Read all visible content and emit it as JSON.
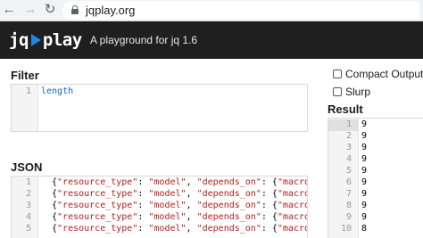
{
  "browser": {
    "url": "jqplay.org",
    "icons": {
      "back": "back-arrow-icon",
      "forward": "forward-arrow-icon",
      "reload": "reload-icon",
      "lock": "lock-icon"
    }
  },
  "header": {
    "logo_jq": "jq",
    "logo_play": "play",
    "tagline": "A playground for jq 1.6",
    "accent": "#1e88e5",
    "background": "#1f1f1f"
  },
  "filter": {
    "label": "Filter",
    "lines": [
      {
        "n": "1",
        "text": "length"
      }
    ]
  },
  "json": {
    "label": "JSON",
    "lines": [
      {
        "n": "1",
        "open": "{",
        "key": "\"resource_type\"",
        "colon": ": ",
        "val": "\"model\"",
        "comma": ", ",
        "key2": "\"depends_on\"",
        "colon2": ": {",
        "key3": "\"macros\""
      },
      {
        "n": "2",
        "open": "{",
        "key": "\"resource_type\"",
        "colon": ": ",
        "val": "\"model\"",
        "comma": ", ",
        "key2": "\"depends_on\"",
        "colon2": ": {",
        "key3": "\"macros\""
      },
      {
        "n": "3",
        "open": "{",
        "key": "\"resource_type\"",
        "colon": ": ",
        "val": "\"model\"",
        "comma": ", ",
        "key2": "\"depends_on\"",
        "colon2": ": {",
        "key3": "\"macros\""
      },
      {
        "n": "4",
        "open": "{",
        "key": "\"resource_type\"",
        "colon": ": ",
        "val": "\"model\"",
        "comma": ", ",
        "key2": "\"depends_on\"",
        "colon2": ": {",
        "key3": "\"macros\""
      },
      {
        "n": "5",
        "open": "{",
        "key": "\"resource_type\"",
        "colon": ": ",
        "val": "\"model\"",
        "comma": ", ",
        "key2": "\"depends_on\"",
        "colon2": ": {",
        "key3": "\"macros\""
      }
    ]
  },
  "options": {
    "compact_output": {
      "label": "Compact Output",
      "checked": false
    },
    "slurp": {
      "label": "Slurp",
      "checked": false
    }
  },
  "result": {
    "label": "Result",
    "lines": [
      {
        "n": "1",
        "text": "9"
      },
      {
        "n": "2",
        "text": "9"
      },
      {
        "n": "3",
        "text": "9"
      },
      {
        "n": "4",
        "text": "9"
      },
      {
        "n": "5",
        "text": "9"
      },
      {
        "n": "6",
        "text": "9"
      },
      {
        "n": "7",
        "text": "9"
      },
      {
        "n": "8",
        "text": "9"
      },
      {
        "n": "9",
        "text": "9"
      },
      {
        "n": "10",
        "text": "8"
      }
    ]
  }
}
